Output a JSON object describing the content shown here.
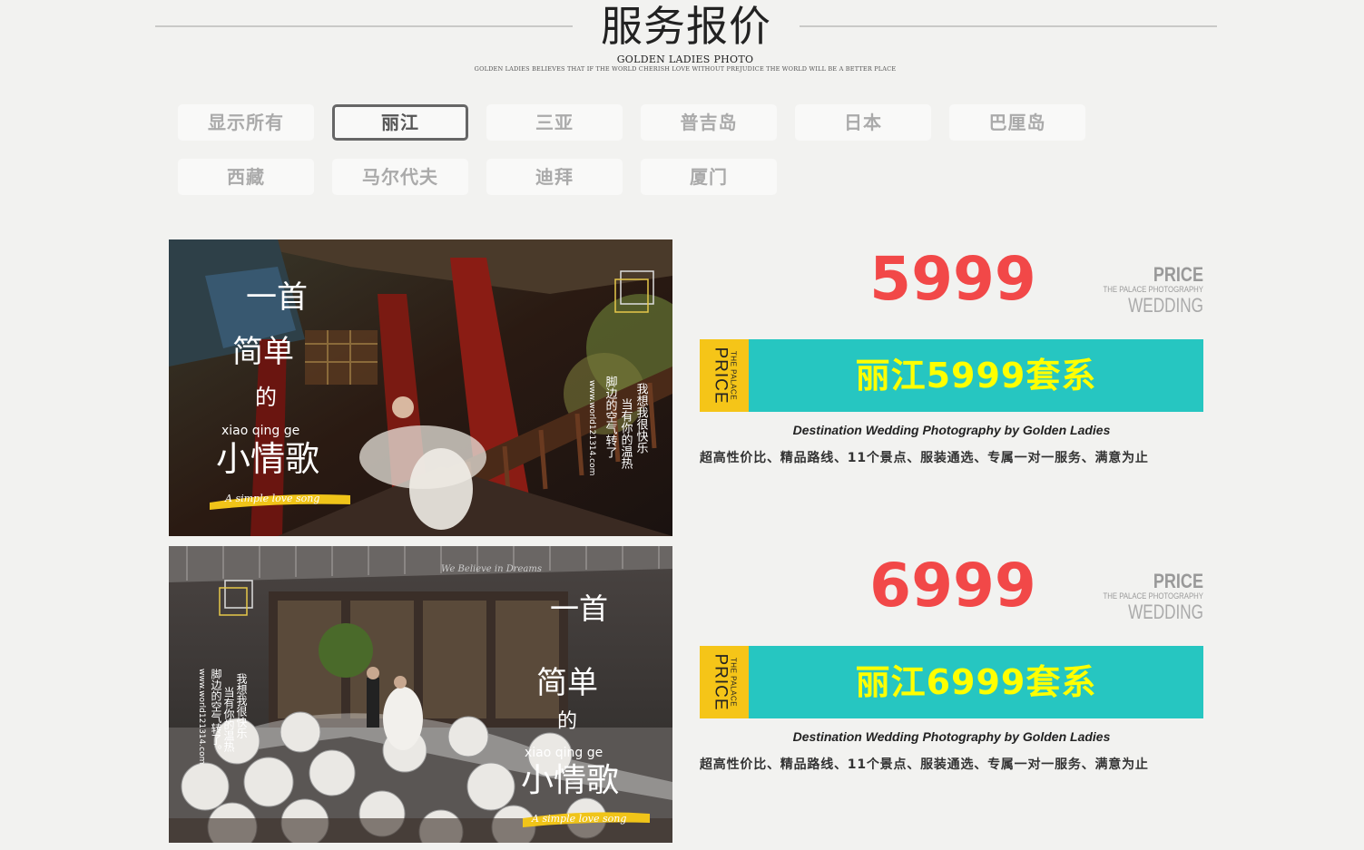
{
  "header": {
    "title": "服务报价",
    "subtitle": "GOLDEN LADIES PHOTO",
    "tagline": "GOLDEN LADIES BELIEVES THAT IF THE WORLD CHERISH LOVE WITHOUT PREJUDICE THE WORLD WILL BE A BETTER PLACE"
  },
  "filters": [
    {
      "label": "显示所有",
      "active": false
    },
    {
      "label": "丽江",
      "active": true
    },
    {
      "label": "三亚",
      "active": false
    },
    {
      "label": "普吉岛",
      "active": false
    },
    {
      "label": "日本",
      "active": false
    },
    {
      "label": "巴厘岛",
      "active": false
    },
    {
      "label": "西藏",
      "active": false
    },
    {
      "label": "马尔代夫",
      "active": false
    },
    {
      "label": "迪拜",
      "active": false
    },
    {
      "label": "厦门",
      "active": false
    }
  ],
  "colors": {
    "price": "#f24848",
    "banner": "#26c6c1",
    "banner_side": "#f5c518",
    "banner_text": "#ffff00"
  },
  "packages": [
    {
      "price": "5999",
      "badge": {
        "line1": "PRICE",
        "line2": "THE PALACE PHOTOGRAPHY",
        "line3": "WEDDING"
      },
      "side": {
        "small": "THE PALACE",
        "big": "PRICE"
      },
      "name": "丽江5999套系",
      "tagline": "Destination Wedding Photography by Golden Ladies",
      "description": "超高性价比、精品路线、11个景点、服装通选、专属一对一服务、满意为止",
      "photo": {
        "title_line1": "一首",
        "title_line2": "简单",
        "title_line3": "的",
        "pinyin": "xiao qing ge",
        "title_line4": "小情歌",
        "song": "A simple love song",
        "lyric1": "我想我很快乐",
        "lyric2": "当有你的温热",
        "lyric3": "脚边的空气转了",
        "url": "www.world121314.com"
      }
    },
    {
      "price": "6999",
      "badge": {
        "line1": "PRICE",
        "line2": "THE PALACE PHOTOGRAPHY",
        "line3": "WEDDING"
      },
      "side": {
        "small": "THE PALACE",
        "big": "PRICE"
      },
      "name": "丽江6999套系",
      "tagline": "Destination Wedding Photography by Golden Ladies",
      "description": "超高性价比、精品路线、11个景点、服装通选、专属一对一服务、满意为止",
      "photo": {
        "title_line1": "一首",
        "title_line2": "简单",
        "title_line3": "的",
        "pinyin": "xiao qing ge",
        "title_line4": "小情歌",
        "song": "A simple love song",
        "lyric1": "我想我很快乐",
        "lyric2": "当有你的温热",
        "lyric3": "脚边的空气转了。",
        "url": "www.world121314.com",
        "sign": "We Believe in Dreams"
      }
    }
  ]
}
